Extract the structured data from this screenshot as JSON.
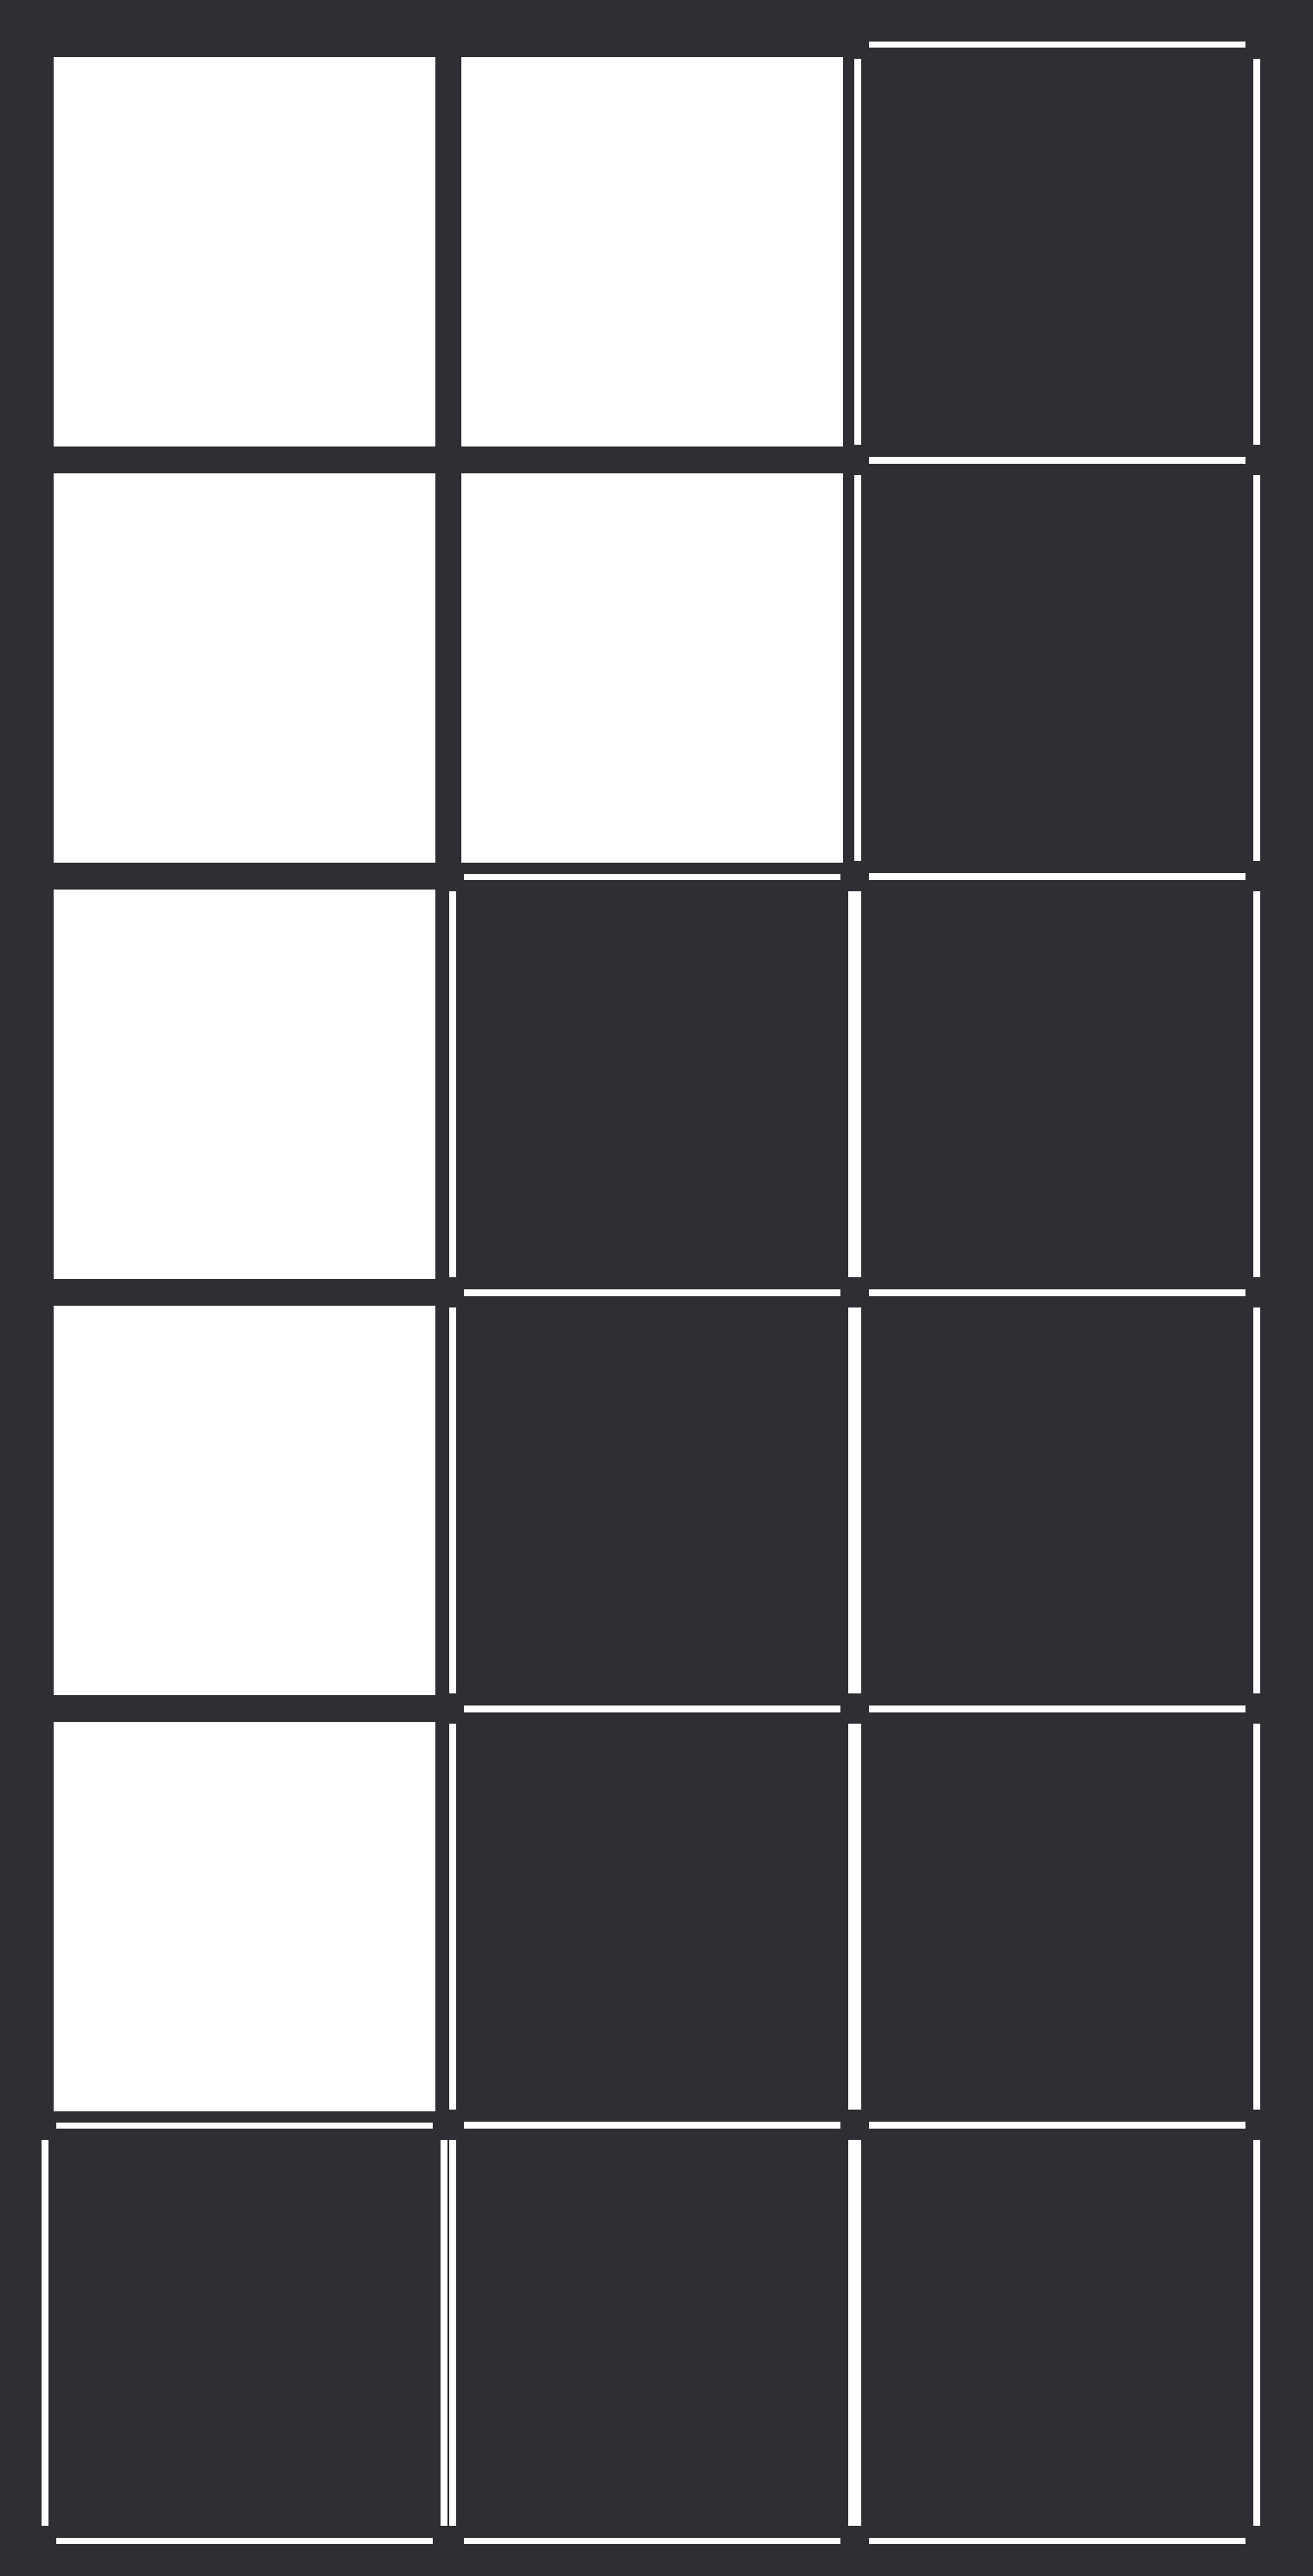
{
  "board": {
    "columns": 3,
    "rows": 6,
    "filled_color": "#ffffff",
    "empty_color": "#2e2f34",
    "cells": [
      [
        "filled",
        "filled",
        "empty"
      ],
      [
        "filled",
        "filled",
        "empty"
      ],
      [
        "filled",
        "empty",
        "empty"
      ],
      [
        "filled",
        "empty",
        "empty"
      ],
      [
        "filled",
        "empty",
        "empty"
      ],
      [
        "empty",
        "empty",
        "empty"
      ]
    ]
  }
}
